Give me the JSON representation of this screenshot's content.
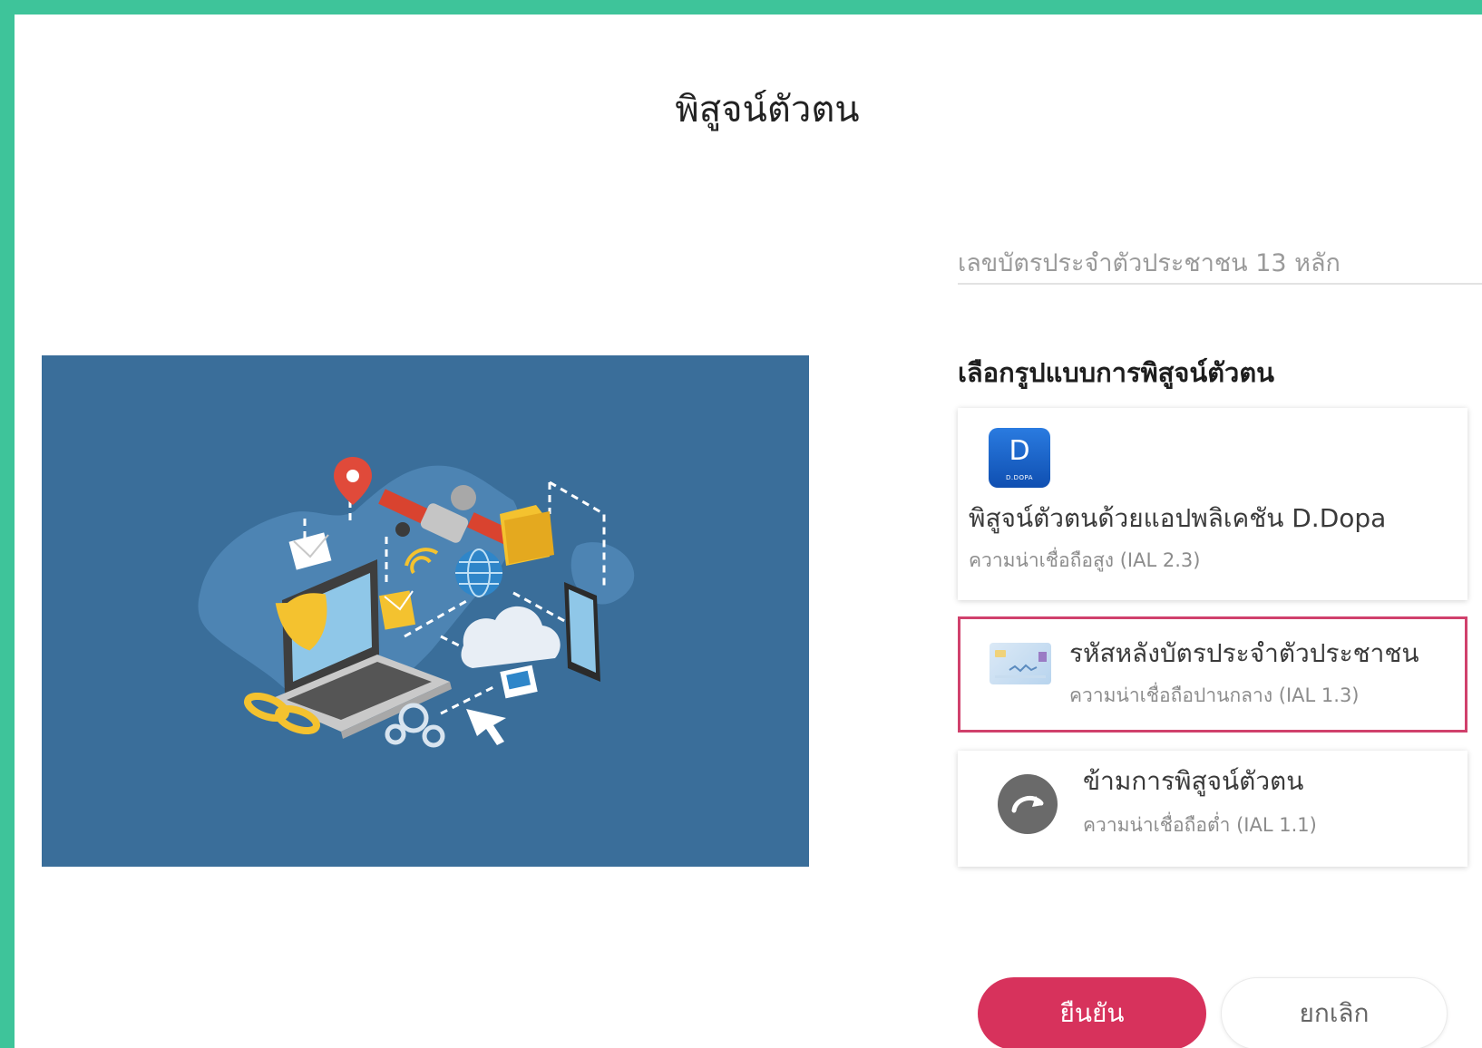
{
  "page": {
    "title": "พิสูจน์ตัวตน"
  },
  "id_input": {
    "placeholder": "เลขบัตรประจำตัวประชาชน 13 หลัก",
    "value": ""
  },
  "method_section": {
    "label": "เลือกรูปแบบการพิสูจน์ตัวตน"
  },
  "options": [
    {
      "icon": "d-dopa-app-icon",
      "icon_letter": "D",
      "icon_caption": "D.DOPA",
      "title": "พิสูจน์ตัวตนด้วยแอปพลิเคชัน D.Dopa",
      "subtitle": "ความน่าเชื่อถือสูง (IAL 2.3)",
      "selected": false
    },
    {
      "icon": "id-card-icon",
      "title": "รหัสหลังบัตรประจำตัวประชาชน",
      "subtitle": "ความน่าเชื่อถือปานกลาง (IAL 1.3)",
      "selected": true
    },
    {
      "icon": "skip-arrow-icon",
      "title": "ข้ามการพิสูจน์ตัวตน",
      "subtitle": "ความน่าเชื่อถือต่ำ (IAL 1.1)",
      "selected": false
    }
  ],
  "buttons": {
    "confirm": "ยืนยัน",
    "cancel": "ยกเลิก"
  },
  "colors": {
    "frame_border": "#3ec49a",
    "accent": "#d7325c",
    "illustration_bg": "#3a6e9a"
  }
}
